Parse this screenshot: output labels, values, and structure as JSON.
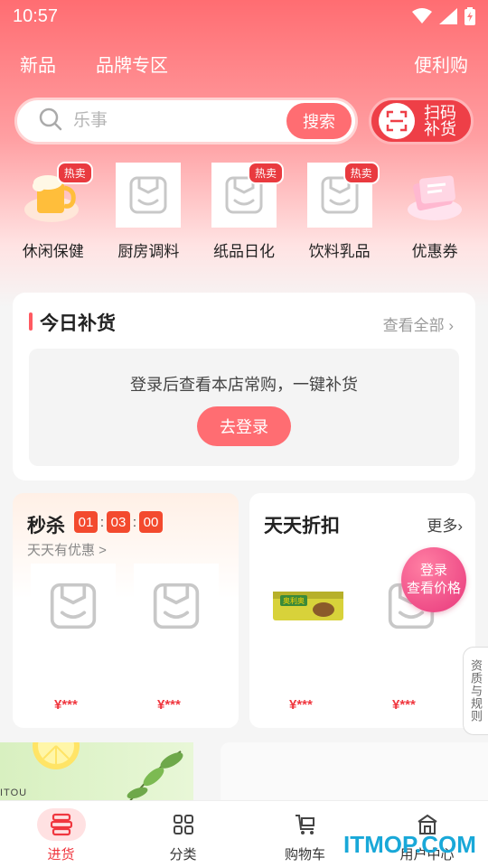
{
  "status_bar": {
    "time": "10:57"
  },
  "top_nav": {
    "items": [
      "新品",
      "品牌专区"
    ],
    "right": "便利购"
  },
  "search": {
    "placeholder": "乐事",
    "button": "搜索"
  },
  "scan": {
    "label": "扫码补货"
  },
  "categories": [
    {
      "label": "休闲保健",
      "hot": "热卖",
      "icon": "beer-icon"
    },
    {
      "label": "厨房调料",
      "hot": "",
      "icon": "placeholder-bag-icon"
    },
    {
      "label": "纸品日化",
      "hot": "热卖",
      "icon": "placeholder-bag-icon"
    },
    {
      "label": "饮料乳品",
      "hot": "热卖",
      "icon": "placeholder-bag-icon"
    },
    {
      "label": "优惠券",
      "hot": "",
      "icon": "coupon-icon"
    }
  ],
  "today": {
    "title": "今日补货",
    "view_all": "查看全部",
    "tip": "登录后查看本店常购，一键补货",
    "login_button": "去登录"
  },
  "flash_sale": {
    "title": "秒杀",
    "timer": [
      "01",
      "03",
      "00"
    ],
    "timer_sep": ":",
    "subtitle": "天天有优惠 >",
    "prices": [
      "¥***",
      "¥***"
    ]
  },
  "discount": {
    "title": "天天折扣",
    "more": "更多",
    "prices": [
      "¥***",
      "¥***"
    ],
    "product_brand": "奥利奥"
  },
  "login_price_bubble": {
    "line1": "登录",
    "line2": "查看价格"
  },
  "qualification_tab": "资质与规则",
  "banner_left_text": "ITOU",
  "tab_bar": [
    {
      "label": "进货",
      "active": true,
      "icon": "cart-stack-icon"
    },
    {
      "label": "分类",
      "active": false,
      "icon": "grid-icon"
    },
    {
      "label": "购物车",
      "active": false,
      "icon": "shopping-cart-icon"
    },
    {
      "label": "用户中心",
      "active": false,
      "icon": "store-icon"
    }
  ],
  "watermark": "ITMOP.COM",
  "colors": {
    "primary": "#ff6d72",
    "accent_red": "#f0373f",
    "hot_badge": "#e93a3f"
  }
}
